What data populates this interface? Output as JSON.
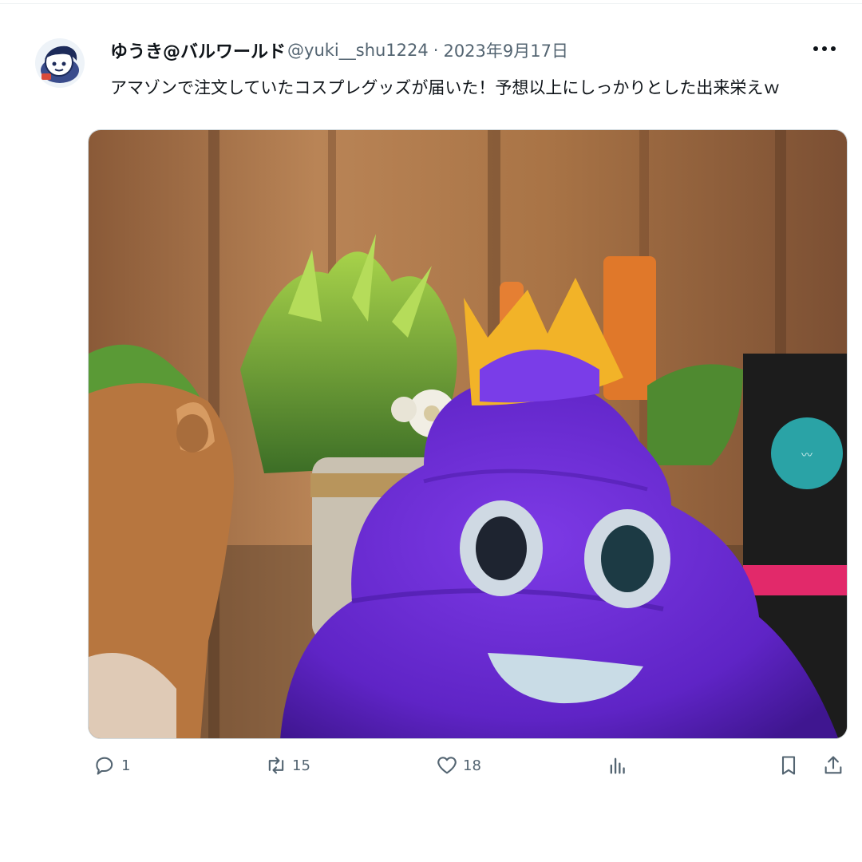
{
  "tweet": {
    "display_name": "ゆうき@バルワールド",
    "handle": "@yuki__shu1224",
    "separator": "·",
    "date": "2023年9月17日",
    "text": "アマゾンで注文していたコスプレグッズが届いた！予想以上にしっかりとした出来栄えｗ"
  },
  "actions": {
    "reply_count": "1",
    "retweet_count": "15",
    "like_count": "18"
  },
  "icons": {
    "more": "more-icon",
    "reply": "reply-icon",
    "retweet": "retweet-icon",
    "like": "heart-icon",
    "views": "analytics-icon",
    "bookmark": "bookmark-icon",
    "share": "share-icon"
  },
  "colors": {
    "text_primary": "#0f1419",
    "text_secondary": "#536471",
    "plush_purple": "#6a2ccf",
    "crown_yellow": "#f2b328"
  }
}
